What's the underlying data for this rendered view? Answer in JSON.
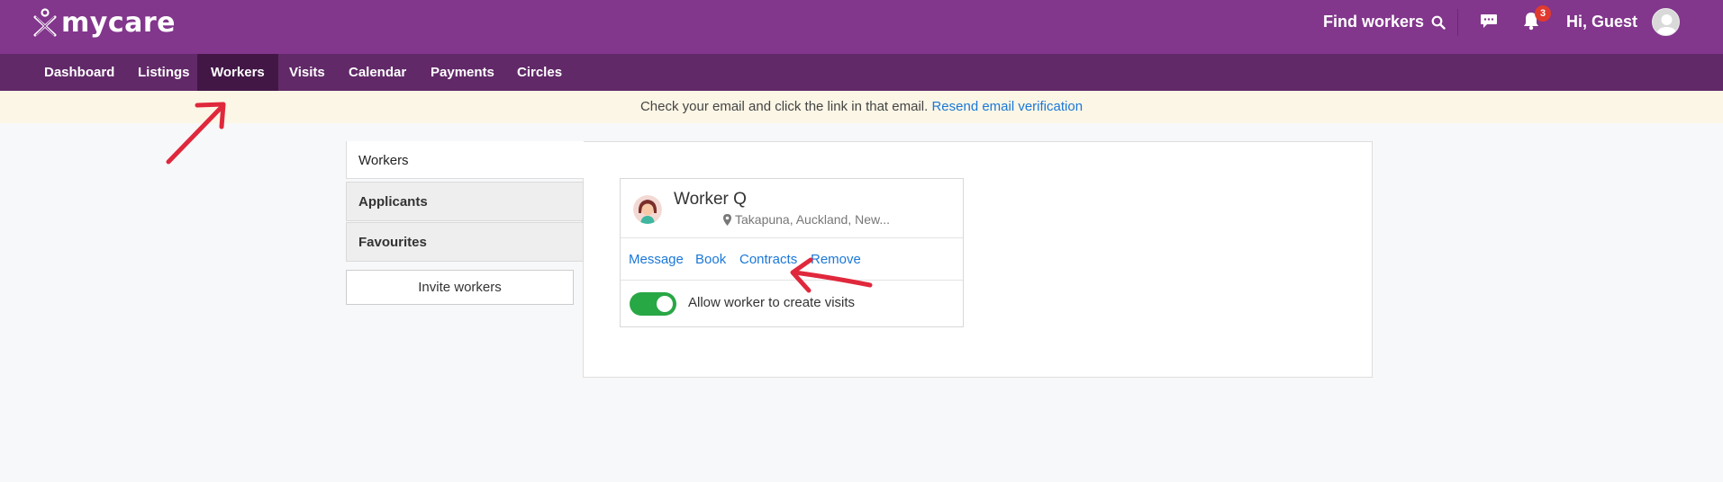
{
  "header": {
    "logo_text": "mycare",
    "find_workers": "Find workers",
    "notification_count": "3",
    "greeting": "Hi, Guest"
  },
  "nav": {
    "items": [
      {
        "label": "Dashboard"
      },
      {
        "label": "Listings"
      },
      {
        "label": "Workers",
        "active": true
      },
      {
        "label": "Visits"
      },
      {
        "label": "Calendar"
      },
      {
        "label": "Payments"
      },
      {
        "label": "Circles"
      }
    ]
  },
  "banner": {
    "message": "Check your email and click the link in that email.",
    "link": "Resend email verification"
  },
  "sidebar": {
    "tabs": [
      {
        "label": "Workers",
        "active": true
      },
      {
        "label": "Applicants"
      },
      {
        "label": "Favourites"
      }
    ],
    "invite_button": "Invite workers"
  },
  "worker_card": {
    "name": "Worker Q",
    "location": "Takapuna, Auckland, New...",
    "actions": [
      "Message",
      "Book",
      "Contracts",
      "Remove"
    ],
    "toggle_label": "Allow worker to create visits",
    "toggle_on": true
  },
  "colors": {
    "header": "#82368c",
    "nav": "#612968",
    "nav_active": "#421746",
    "banner": "#fcf6e6",
    "link": "#1a78d8",
    "toggle": "#28a745",
    "annotation": "#e0283c"
  }
}
